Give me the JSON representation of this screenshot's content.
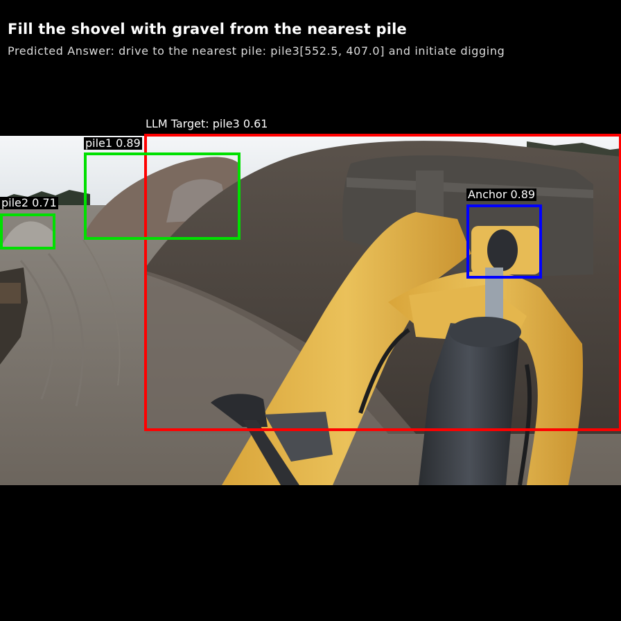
{
  "header": {
    "title": "Fill the shovel with gravel from the nearest pile",
    "predicted_answer": "Predicted Answer: drive to the nearest pile: pile3[552.5, 407.0] and initiate digging"
  },
  "detections": [
    {
      "label": "LLM Target: pile3 0.61",
      "color": "#ff0000"
    },
    {
      "label": "pile1 0.89",
      "color": "#00e000"
    },
    {
      "label": "pile2 0.71",
      "color": "#00e000"
    },
    {
      "label": "Anchor 0.89",
      "color": "#0000ff"
    }
  ]
}
